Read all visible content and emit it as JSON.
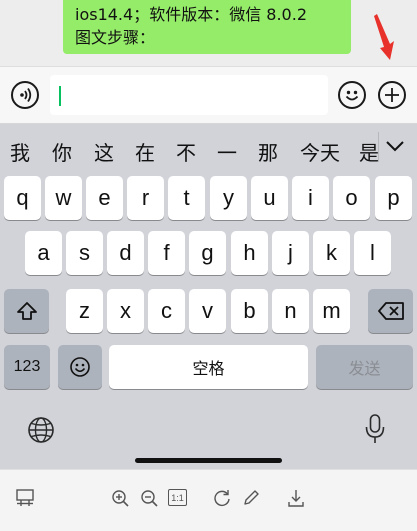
{
  "chat": {
    "bubble_line1": "ios14.4；软件版本：微信 8.0.2",
    "bubble_line2": "图文步骤："
  },
  "input": {
    "value": "",
    "placeholder": ""
  },
  "candidates": [
    "我",
    "你",
    "这",
    "在",
    "不",
    "一",
    "那",
    "今天",
    "是"
  ],
  "keyboard": {
    "row1": [
      "q",
      "w",
      "e",
      "r",
      "t",
      "y",
      "u",
      "i",
      "o",
      "p"
    ],
    "row2": [
      "a",
      "s",
      "d",
      "f",
      "g",
      "h",
      "j",
      "k",
      "l"
    ],
    "row3": [
      "z",
      "x",
      "c",
      "v",
      "b",
      "n",
      "m"
    ],
    "numbers_label": "123",
    "space_label": "空格",
    "send_label": "发送"
  },
  "icons": {
    "voice": "voice-icon",
    "emoji": "emoji-icon",
    "plus": "plus-icon",
    "shift": "shift-icon",
    "backspace": "backspace-icon",
    "globe": "globe-icon",
    "mic": "microphone-icon",
    "expand": "chevron-down-icon"
  },
  "toolbar": {
    "zoom_reset_label": "1:1",
    "icons": [
      "layout-icon",
      "zoom-in-icon",
      "zoom-out-icon",
      "actual-size-icon",
      "rotate-icon",
      "edit-icon",
      "download-icon"
    ]
  },
  "colors": {
    "bubble": "#95ec69",
    "arrow": "#e8312a",
    "caret": "#07c160",
    "keyboard_bg": "#d1d3d9",
    "function_key": "#adb3bc"
  }
}
